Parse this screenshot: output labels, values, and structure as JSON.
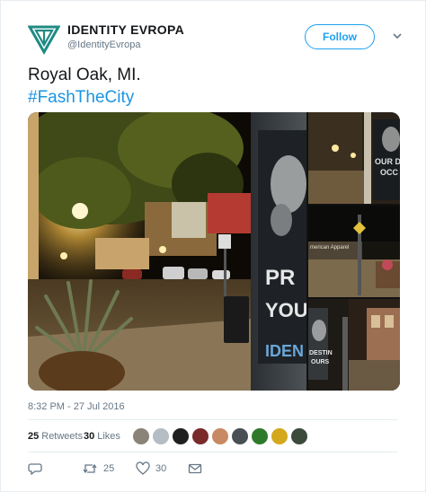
{
  "account": {
    "name": "IDENTITY EVROPA",
    "handle": "@IdentityEvropa",
    "follow_label": "Follow"
  },
  "tweet": {
    "line1": "Royal Oak, MI.",
    "hashtag": "#FashTheCity",
    "timestamp": "8:32 PM - 27 Jul 2016"
  },
  "media": {
    "main_sign_text_1": "PR",
    "main_sign_text_2": "YOUR",
    "main_sign_text_3": "IDEN",
    "thumb1_text_1": "OUR D",
    "thumb1_text_2": "OCC",
    "thumb2_text": "merican Apparel",
    "thumb3_text_1": "DESTIN",
    "thumb3_text_2": "OURS"
  },
  "stats": {
    "retweets_count": "25",
    "retweets_label": "Retweets",
    "likes_count": "30",
    "likes_label": "Likes"
  },
  "actions": {
    "retweet_count": "25",
    "like_count": "30"
  },
  "colors": {
    "brand_blue": "#1da1f2",
    "hashtag_blue": "#1b95e0",
    "logo_teal": "#1f8a84",
    "muted_text": "#657786"
  }
}
